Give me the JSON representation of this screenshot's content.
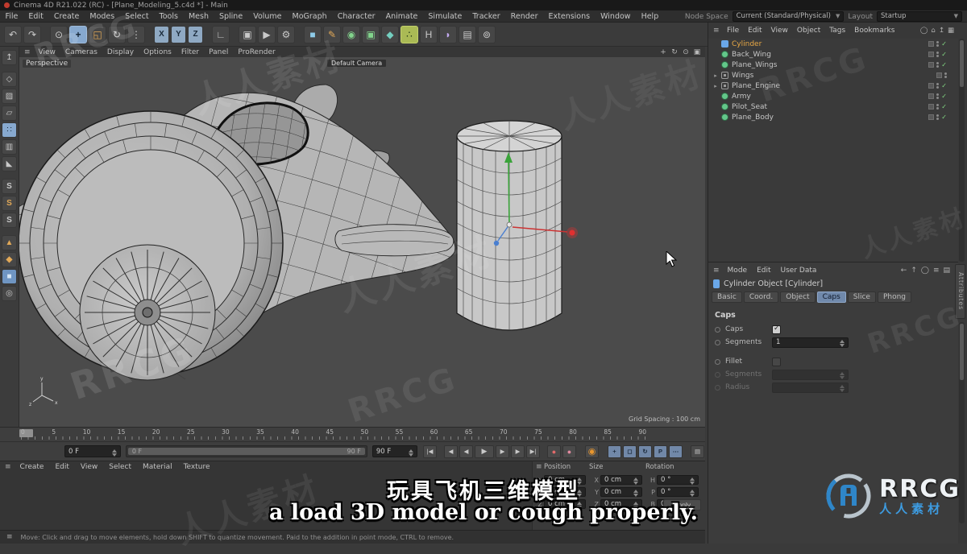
{
  "window": {
    "title": "Cinema 4D R21.022 (RC) - [Plane_Modeling_5.c4d *] - Main"
  },
  "menu_bar": {
    "items": [
      "File",
      "Edit",
      "Create",
      "Modes",
      "Select",
      "Tools",
      "Mesh",
      "Spline",
      "Volume",
      "MoGraph",
      "Character",
      "Animate",
      "Simulate",
      "Tracker",
      "Render",
      "Extensions",
      "Window",
      "Help"
    ]
  },
  "node_space": {
    "label": "Node Space",
    "value": "Current (Standard/Physical)"
  },
  "layout_picker": {
    "label": "Layout",
    "value": "Startup"
  },
  "toolbar": {
    "items": [
      {
        "name": "undo-icon",
        "glyph": "↶"
      },
      {
        "name": "redo-icon",
        "glyph": "↷"
      },
      {
        "name": "live-selection-icon",
        "glyph": "⊙"
      },
      {
        "name": "move-tool-icon",
        "glyph": "+"
      },
      {
        "name": "scale-tool-icon",
        "glyph": "◱"
      },
      {
        "name": "rotate-tool-icon",
        "glyph": "↻"
      },
      {
        "name": "last-used-tool-icon",
        "glyph": "⋮"
      },
      {
        "name": "lock-x-axis",
        "glyph": "X"
      },
      {
        "name": "lock-y-axis",
        "glyph": "Y"
      },
      {
        "name": "lock-z-axis",
        "glyph": "Z"
      },
      {
        "name": "coordinate-system-icon",
        "glyph": "∟"
      },
      {
        "name": "render-view-icon",
        "glyph": "▣"
      },
      {
        "name": "render-picture-viewer-icon",
        "glyph": "▶"
      },
      {
        "name": "render-settings-icon",
        "glyph": "⚙"
      },
      {
        "name": "primitive-cube-icon",
        "glyph": "■"
      },
      {
        "name": "pen-spline-icon",
        "glyph": "✎"
      },
      {
        "name": "subdivision-surface-icon",
        "glyph": "◉"
      },
      {
        "name": "instance-icon",
        "glyph": "▣"
      },
      {
        "name": "volume-icon",
        "glyph": "◆"
      },
      {
        "name": "mograph-cloner-icon",
        "glyph": "∴"
      },
      {
        "name": "symmetry-icon",
        "glyph": "H"
      },
      {
        "name": "deformer-icon",
        "glyph": "◗"
      },
      {
        "name": "content-browser-icon",
        "glyph": "▤"
      },
      {
        "name": "team-render-icon",
        "glyph": "⊚"
      }
    ]
  },
  "left_palette": {
    "items": [
      {
        "name": "make-editable-icon",
        "glyph": "↥"
      },
      {
        "name": "model-mode-icon",
        "glyph": "◇"
      },
      {
        "name": "texture-mode-icon",
        "glyph": "▨"
      },
      {
        "name": "workplane-mode-icon",
        "glyph": "▱"
      },
      {
        "name": "points-mode-icon",
        "glyph": "∷"
      },
      {
        "name": "edges-mode-icon",
        "glyph": "▥"
      },
      {
        "name": "polygons-mode-icon",
        "glyph": "◣"
      },
      {
        "name": "enable-snap-icon",
        "glyph": "S"
      },
      {
        "name": "snap-3d-icon",
        "glyph": "S"
      },
      {
        "name": "snap-2d-icon",
        "glyph": "S"
      },
      {
        "name": "modeling-axis-icon",
        "glyph": "▲"
      },
      {
        "name": "axis-snap-icon",
        "glyph": "◆"
      },
      {
        "name": "viewport-filter-icon",
        "glyph": "■"
      },
      {
        "name": "display-palette-icon",
        "glyph": "◎"
      }
    ]
  },
  "viewport": {
    "menus": [
      "View",
      "Cameras",
      "Display",
      "Options",
      "Filter",
      "Panel",
      "ProRender"
    ],
    "view_label": "Perspective",
    "camera_label": "Default Camera",
    "grid_spacing": "Grid Spacing : 100 cm",
    "nav_icons": [
      {
        "name": "pan-view-icon",
        "glyph": "+"
      },
      {
        "name": "orbit-view-icon",
        "glyph": "↻"
      },
      {
        "name": "zoom-view-icon",
        "glyph": "⊙"
      },
      {
        "name": "maximize-view-icon",
        "glyph": "▣"
      }
    ]
  },
  "object_manager": {
    "menus": [
      "File",
      "Edit",
      "View",
      "Object",
      "Tags",
      "Bookmarks"
    ],
    "header_icons": [
      {
        "name": "search-icon",
        "glyph": "◯"
      },
      {
        "name": "home-icon",
        "glyph": "⌂"
      },
      {
        "name": "up-icon",
        "glyph": "↥"
      },
      {
        "name": "grid-icon",
        "glyph": "▦"
      }
    ],
    "objects": [
      {
        "name": "Cylinder"
      },
      {
        "name": "Back_Wing"
      },
      {
        "name": "Plane_Wings"
      },
      {
        "name": "Wings"
      },
      {
        "name": "Plane_Engine"
      },
      {
        "name": "Army"
      },
      {
        "name": "Pilot_Seat"
      },
      {
        "name": "Plane_Body"
      }
    ]
  },
  "attribute_manager": {
    "menus": [
      "Mode",
      "Edit",
      "User Data"
    ],
    "header_icons": [
      {
        "name": "back-icon",
        "glyph": "←"
      },
      {
        "name": "up-icon",
        "glyph": "↑"
      },
      {
        "name": "search-icon",
        "glyph": "◯"
      },
      {
        "name": "lock-icon",
        "glyph": "≡"
      },
      {
        "name": "panel-icon",
        "glyph": "▤"
      }
    ],
    "object_title": "Cylinder Object [Cylinder]",
    "tabs": [
      "Basic",
      "Coord.",
      "Object",
      "Caps",
      "Slice",
      "Phong"
    ],
    "active_tab": "Caps",
    "section_title": "Caps",
    "rows": [
      {
        "label": "Caps",
        "value": "checked"
      },
      {
        "label": "Segments",
        "value": "1"
      },
      {
        "label": "Fillet",
        "value": "unchecked"
      },
      {
        "label": "Segments",
        "value": ""
      },
      {
        "label": "Radius",
        "value": ""
      }
    ],
    "side_tab": "Attributes"
  },
  "timeline": {
    "ticks": [
      "0",
      "5",
      "10",
      "15",
      "20",
      "25",
      "30",
      "35",
      "40",
      "45",
      "50",
      "55",
      "60",
      "65",
      "70",
      "75",
      "80",
      "85",
      "90"
    ],
    "current_frame": "0 F",
    "range_start": "0 F",
    "range_end": "90 F",
    "end_frame": "90 F"
  },
  "playback": {
    "items": [
      {
        "name": "goto-start-icon",
        "glyph": "|◀"
      },
      {
        "name": "prev-key-icon",
        "glyph": "◀"
      },
      {
        "name": "prev-frame-icon",
        "glyph": "◀"
      },
      {
        "name": "play-icon",
        "glyph": "▶"
      },
      {
        "name": "next-frame-icon",
        "glyph": "▶"
      },
      {
        "name": "next-key-icon",
        "glyph": "▶"
      },
      {
        "name": "goto-end-icon",
        "glyph": "▶|"
      },
      {
        "name": "record-keyframe-icon",
        "glyph": "●"
      },
      {
        "name": "record-objects-icon",
        "glyph": "●"
      },
      {
        "name": "autokey-icon",
        "glyph": "◉"
      },
      {
        "name": "key-position-icon",
        "glyph": "+"
      },
      {
        "name": "key-scale-icon",
        "glyph": "◻"
      },
      {
        "name": "key-rotation-icon",
        "glyph": "↻"
      },
      {
        "name": "key-parameter-icon",
        "glyph": "P"
      },
      {
        "name": "key-pla-icon",
        "glyph": "⋯"
      },
      {
        "name": "sound-icon",
        "glyph": "▤"
      }
    ]
  },
  "coordinates": {
    "headers": [
      "Position",
      "Size",
      "Rotation"
    ],
    "position": [
      {
        "axis": "X",
        "value": "0 cm"
      },
      {
        "axis": "Y",
        "value": "0 cm"
      },
      {
        "axis": "Z",
        "value": "0 cm"
      }
    ],
    "size": [
      {
        "axis": "X",
        "value": "0 cm"
      },
      {
        "axis": "Y",
        "value": "0 cm"
      },
      {
        "axis": "Z",
        "value": "0 cm"
      }
    ],
    "rotation": [
      {
        "axis": "H",
        "value": "0 °"
      },
      {
        "axis": "P",
        "value": "0 °"
      },
      {
        "axis": "B",
        "value": "0 °"
      }
    ],
    "apply_label": "Apply"
  },
  "material_manager": {
    "menus": [
      "Create",
      "Edit",
      "View",
      "Select",
      "Material",
      "Texture"
    ]
  },
  "status_bar": {
    "text": "Move: Click and drag to move elements, hold down SHIFT to quantize movement. Paid to the addition in point mode, CTRL to remove."
  },
  "subtitles": {
    "line1": "玩具飞机三维模型",
    "line2": "a load 3D model or cough properly."
  },
  "watermark": {
    "text": "人人素材",
    "brand": "RRCG",
    "logo_title": "RRCG",
    "logo_subtitle": "人人素材"
  },
  "colors": {
    "accent_blue": "#87a9cf",
    "selected_orange": "#e8a845",
    "axis_red": "#d23434",
    "axis_green": "#3aa33a",
    "axis_blue": "#4a7fd0",
    "logo_blue": "#3d9be0"
  }
}
